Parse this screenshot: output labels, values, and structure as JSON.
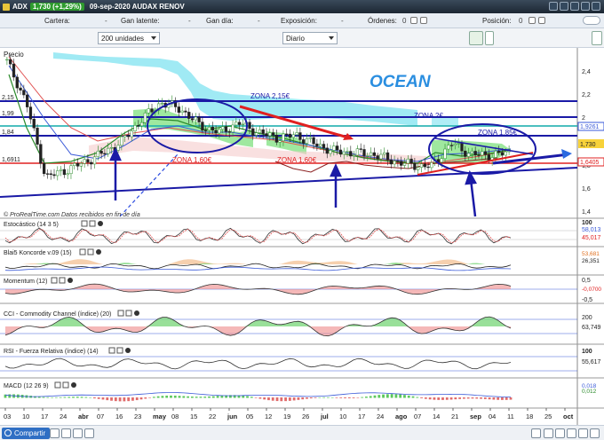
{
  "window": {
    "ticker": "ADX",
    "price_change": "1,730 (+1,29%)",
    "date_name": "09-sep-2020  AUDAX RENOV"
  },
  "positions_bar": {
    "cartera_label": "Cartera:",
    "cartera_value": "-",
    "ganlat_label": "Gan latente:",
    "ganlat_value": "-",
    "gandia_label": "Gan día:",
    "gandia_value": "-",
    "exposicion_label": "Exposición:",
    "exposicion_value": "-",
    "ordenes_label": "Órdenes:",
    "ordenes_value": "0",
    "posicion_label": "Posición:",
    "posicion_value": "0"
  },
  "toolbar": {
    "units_select": "200 unidades",
    "period_select": "Diario"
  },
  "panels": {
    "price_label": "Precio",
    "watermark": "© ProRealTime.com  Datos recibidos en fin de día",
    "stoch_label": "Estocástico (14 3 5)",
    "blai_label": "Blai5 Koncorde v.09 (15)",
    "momentum_label": "Momentum (12)",
    "cci_label": "CCI - Commodity Channel (índice) (20)",
    "rsi_label": "RSI - Fuerza Relativa (índice) (14)",
    "macd_label": "MACD (12 26 9)"
  },
  "annotations": {
    "ocean": "OCEAN",
    "zona_215": "ZONA 2,15€",
    "zona_2": "ZONA 2€",
    "zona_185": "ZONA 1,85€",
    "zona_160_a": "ZONA 1,60€",
    "zona_160_b": "ZONA 1,60€"
  },
  "left_price_labels": [
    "2,15",
    "1,99",
    "1,84",
    "1,6911"
  ],
  "right_axis": {
    "price_ticks": [
      "2,4",
      "2,2",
      "2",
      "1,8",
      "1,6",
      "1,4"
    ],
    "price_tags": [
      "1,9261",
      "1,730",
      "1,6405"
    ],
    "stoch_ticks": [
      "100",
      "58,013",
      "45,017"
    ],
    "blai_ticks": [
      "53,681",
      "26,351"
    ],
    "momentum_ticks": [
      "0,5",
      "-0,0700",
      "-0,5"
    ],
    "cci_ticks": [
      "200",
      "63,749"
    ],
    "rsi_ticks": [
      "100",
      "55,617"
    ],
    "macd_ticks": [
      "0,018",
      "0,012"
    ]
  },
  "time_axis": [
    "03",
    "10",
    "17",
    "24",
    "abr",
    "07",
    "16",
    "23",
    "may",
    "08",
    "15",
    "22",
    "jun",
    "05",
    "12",
    "19",
    "26",
    "jul",
    "10",
    "17",
    "24",
    "ago",
    "07",
    "14",
    "21",
    "sep",
    "04",
    "11",
    "18",
    "25",
    "oct"
  ],
  "bottom": {
    "share_button": "Compartir"
  },
  "colors": {
    "zone_blue": "#1a1aa6",
    "red_line": "#e02020",
    "green_fill": "#7fe07f",
    "cloud": "#7fe3f0",
    "ocean_text": "#2a8ee0"
  },
  "chart_data": {
    "type": "line",
    "series": [
      {
        "name": "",
        "x": [
          "03",
          "10",
          "17",
          "24",
          "abr",
          "07",
          "16",
          "23",
          "may",
          "08",
          "15",
          "22",
          "jun",
          "05",
          "12",
          "19",
          "26",
          "jul",
          "10",
          "17",
          "24",
          "ago",
          "07",
          "14",
          "21",
          "sep",
          "04"
        ],
        "values": [
          2.4,
          2.1,
          1.55,
          1.6,
          1.66,
          1.73,
          1.82,
          1.98,
          2.1,
          2.05,
          1.93,
          1.88,
          1.95,
          1.88,
          1.84,
          1.86,
          1.79,
          1.74,
          1.73,
          1.72,
          1.67,
          1.64,
          1.63,
          1.8,
          1.72,
          1.71,
          1.73
        ]
      }
    ],
    "ylim": [
      1.25,
      2.5
    ],
    "title": "",
    "xlabel": "",
    "ylabel": ""
  }
}
